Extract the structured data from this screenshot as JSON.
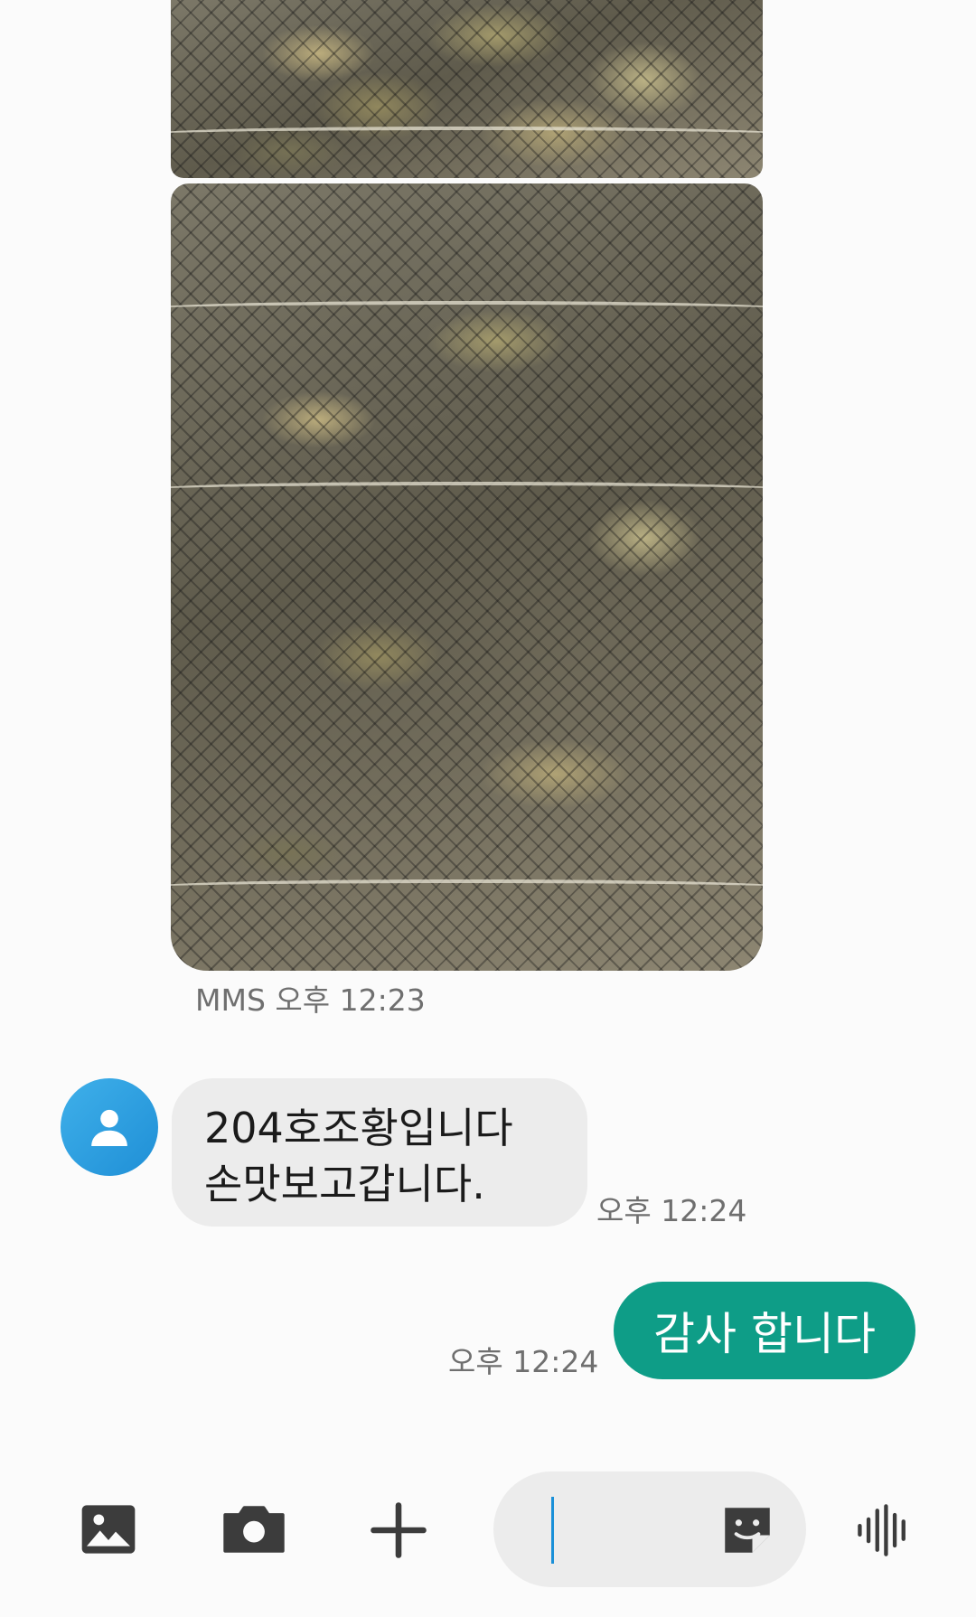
{
  "messages": [
    {
      "type": "image",
      "direction": "incoming",
      "label": "MMS",
      "time": "오후 12:23"
    },
    {
      "type": "text",
      "direction": "incoming",
      "lines": [
        "204호조황입니다",
        "손맛보고갑니다."
      ],
      "time": "오후 12:24"
    },
    {
      "type": "text",
      "direction": "outgoing",
      "text": "감사 합니다",
      "time": "오후 12:24"
    }
  ],
  "mms_meta": "MMS 오후 12:23",
  "input": {
    "value": ""
  },
  "toolbar": {
    "icons": [
      "gallery-icon",
      "camera-icon",
      "plus-icon",
      "sticker-icon",
      "voice-wave-icon"
    ]
  },
  "colors": {
    "accent": "#0e9d87",
    "incoming_bubble": "#ececec",
    "avatar": "#2a9fe3",
    "caret": "#1a90d8",
    "background": "#fbfbfb"
  }
}
